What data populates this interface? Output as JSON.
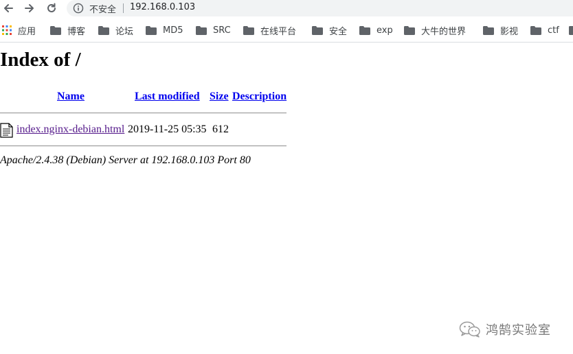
{
  "browser": {
    "security_label": "不安全",
    "url": "192.168.0.103",
    "bookmarks": [
      {
        "label": "应用",
        "icon": "apps-grid-icon"
      },
      {
        "label": "博客",
        "icon": "folder-icon"
      },
      {
        "label": "论坛",
        "icon": "folder-icon"
      },
      {
        "label": "MD5",
        "icon": "folder-icon"
      },
      {
        "label": "SRC",
        "icon": "folder-icon"
      },
      {
        "label": "在线平台",
        "icon": "folder-icon"
      },
      {
        "label": "安全",
        "icon": "folder-icon"
      },
      {
        "label": "exp",
        "icon": "folder-icon"
      },
      {
        "label": "大牛的世界",
        "icon": "folder-icon"
      },
      {
        "label": "影视",
        "icon": "folder-icon"
      },
      {
        "label": "ctf",
        "icon": "folder-icon"
      }
    ]
  },
  "page": {
    "title": "Index of /",
    "columns": {
      "name": "Name",
      "last_modified": "Last modified",
      "size": "Size",
      "description": "Description"
    },
    "files": [
      {
        "icon": "text-file-icon",
        "name": "index.nginx-debian.html",
        "last_modified": "2019-11-25 05:35",
        "size": "612",
        "description": ""
      }
    ],
    "server_signature": "Apache/2.4.38 (Debian) Server at 192.168.0.103 Port 80"
  },
  "watermark": {
    "text": "鸿鹄实验室",
    "icon": "wechat-icon"
  },
  "colors": {
    "link": "#0000ee",
    "visited_link": "#551a8b",
    "omnibox_bg": "#f1f3f4",
    "folder": "#5f6368"
  }
}
